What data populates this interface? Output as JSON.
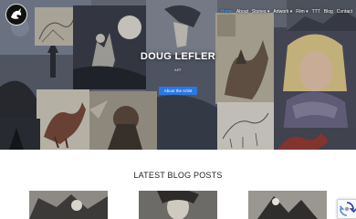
{
  "nav": {
    "items": [
      {
        "label": "Home",
        "active": true
      },
      {
        "label": "About"
      },
      {
        "label": "Stories ▾"
      },
      {
        "label": "Artwork ▾"
      },
      {
        "label": "Film ▾"
      },
      {
        "label": "TTT"
      },
      {
        "label": "Blog"
      },
      {
        "label": "Contact"
      }
    ]
  },
  "hero": {
    "title": "DOUG LEFLER",
    "subtitle": "ART",
    "button_label": "About the Artist"
  },
  "blog": {
    "section_title": "LATEST BLOG POSTS"
  },
  "icons": {
    "logo": "dragon-logo-icon",
    "recaptcha": "recaptcha-icon"
  },
  "colors": {
    "accent": "#2a78e4",
    "nav_active": "#4aa3ff"
  }
}
